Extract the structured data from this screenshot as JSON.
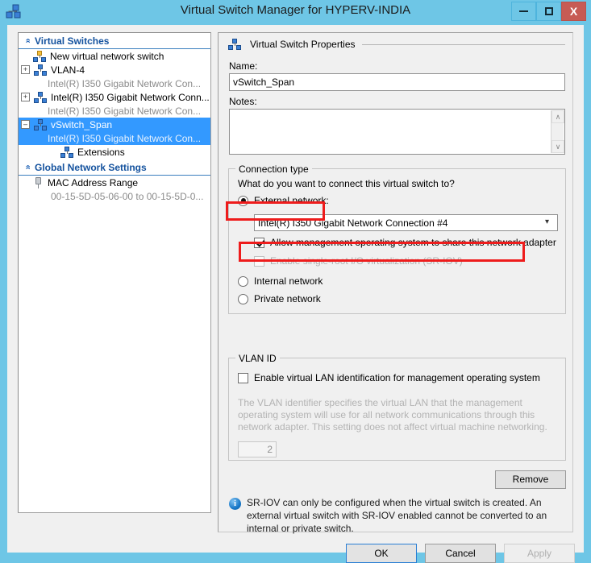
{
  "window": {
    "title": "Virtual Switch Manager for HYPERV-INDIA",
    "icon": "virtual-switch-icon",
    "minimize_label": "–",
    "maximize_label": "□",
    "close_label": "X"
  },
  "sidebar": {
    "groups": [
      {
        "label": "Virtual Switches",
        "collapse_icon": "«",
        "items": [
          {
            "label": "New virtual network switch",
            "icon": "new-switch-icon",
            "expander": "",
            "indent": 1,
            "selected": false,
            "sub": ""
          },
          {
            "label": "VLAN-4",
            "icon": "switch-icon",
            "expander": "+",
            "indent": 0,
            "selected": false,
            "sub": "Intel(R) I350 Gigabit Network Con..."
          },
          {
            "label": "Intel(R) I350 Gigabit Network Conn...",
            "icon": "switch-icon",
            "expander": "+",
            "indent": 0,
            "selected": false,
            "sub": "Intel(R) I350 Gigabit Network Con..."
          },
          {
            "label": "vSwitch_Span",
            "icon": "switch-icon",
            "expander": "–",
            "indent": 0,
            "selected": true,
            "sub": "Intel(R) I350 Gigabit Network Con..."
          },
          {
            "label": "Extensions",
            "icon": "switch-icon",
            "expander": "",
            "indent": 2,
            "selected": false,
            "sub": ""
          }
        ]
      },
      {
        "label": "Global Network Settings",
        "collapse_icon": "«",
        "items": [
          {
            "label": "MAC Address Range",
            "icon": "mac-range-icon",
            "expander": "",
            "indent": 1,
            "selected": false,
            "sub": "00-15-5D-05-06-00 to 00-15-5D-0..."
          }
        ]
      }
    ]
  },
  "main": {
    "group_title": "Virtual Switch Properties",
    "group_icon": "switch-icon",
    "name_label": "Name:",
    "name_value": "vSwitch_Span",
    "notes_label": "Notes:",
    "notes_value": "",
    "notes_scroll_up": "∧",
    "notes_scroll_down": "∨",
    "connection_type": {
      "legend": "Connection type",
      "question": "What do you want to connect this virtual switch to?",
      "external_label": "External network:",
      "external_selected": true,
      "adapter_value": "Intel(R) I350 Gigabit Network Connection #4",
      "adapter_dropdown_icon": "chevron-down-icon",
      "allow_mgmt_label": "Allow management operating system to share this network adapter",
      "allow_mgmt_checked": true,
      "sriov_label": "Enable single-root I/O virtualization (SR-IOV)",
      "sriov_checked": false,
      "sriov_disabled": true,
      "internal_label": "Internal network",
      "internal_selected": false,
      "private_label": "Private network",
      "private_selected": false
    },
    "vlan": {
      "legend": "VLAN ID",
      "enable_label": "Enable virtual LAN identification for management operating system",
      "enable_checked": false,
      "help": "The VLAN identifier specifies the virtual LAN that the management operating system will use for all network communications through this network adapter. This setting does not affect virtual machine networking.",
      "id_value": "2"
    },
    "remove_label": "Remove",
    "info_icon": "info-icon",
    "info_text": "SR-IOV can only be configured when the virtual switch is created. An external virtual switch with SR-IOV enabled cannot be converted to an internal or private switch."
  },
  "footer": {
    "ok_label": "OK",
    "cancel_label": "Cancel",
    "apply_label": "Apply",
    "apply_disabled": true
  },
  "annotations": {
    "highlight_color": "#ee1c1c",
    "boxes": [
      {
        "name": "external-network-highlight"
      },
      {
        "name": "allow-management-highlight"
      }
    ]
  }
}
